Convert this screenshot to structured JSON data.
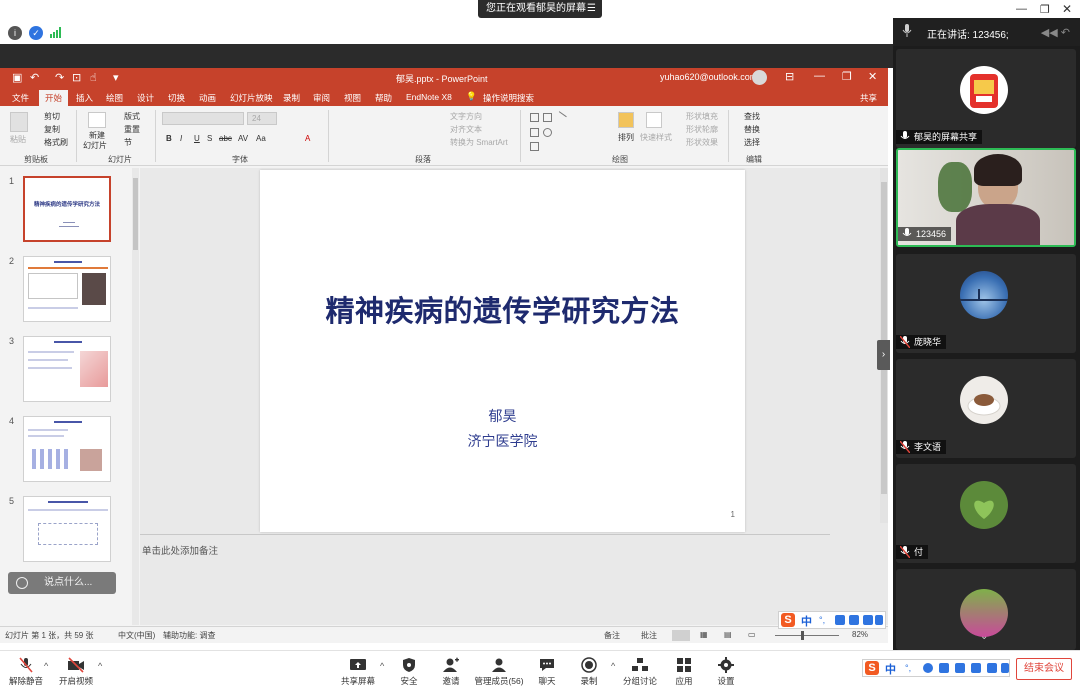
{
  "topbar": {
    "share_banner": "您正在观看郁昊的屏幕"
  },
  "ppt": {
    "doc_title": "郁昊.pptx - PowerPoint",
    "account": "yuhao620@outlook.com",
    "share_label": "共享",
    "tabs": [
      "文件",
      "开始",
      "插入",
      "绘图",
      "设计",
      "切换",
      "动画",
      "幻灯片放映",
      "录制",
      "审阅",
      "视图",
      "帮助",
      "EndNote X8",
      "操作说明搜索"
    ],
    "ribbon": {
      "clipboard": {
        "label": "剪贴板",
        "paste": "粘贴",
        "cut": "剪切",
        "copy": "复制",
        "format_painter": "格式刷"
      },
      "slides": {
        "label": "幻灯片",
        "new_slide": "新建",
        "new_slide2": "幻灯片",
        "layout": "版式",
        "reset": "重置",
        "section": "节"
      },
      "font": {
        "label": "字体",
        "size": "24",
        "bold": "B",
        "italic": "I",
        "underline": "U",
        "shadow": "S",
        "strike": "abc",
        "spacing": "AV",
        "case": "Aa",
        "color_a": "A"
      },
      "paragraph": {
        "label": "段落",
        "text_dir": "文字方向",
        "align_text": "对齐文本",
        "smartart": "转换为 SmartArt"
      },
      "drawing": {
        "label": "绘图",
        "arrange": "排列",
        "quick_styles": "快速样式",
        "fill": "形状填充",
        "outline": "形状轮廓",
        "effects": "形状效果"
      },
      "editing": {
        "label": "编辑",
        "find": "查找",
        "replace": "替换",
        "select": "选择"
      }
    },
    "thumbnails": [
      {
        "num": "1",
        "title": "精神疾病的遗传学研究方法"
      },
      {
        "num": "2",
        "title": ""
      },
      {
        "num": "3",
        "title": ""
      },
      {
        "num": "4",
        "title": ""
      },
      {
        "num": "5",
        "title": ""
      }
    ],
    "slide": {
      "title": "精神疾病的遗传学研究方法",
      "author": "郁昊",
      "institution": "济宁医学院",
      "page": "1"
    },
    "notes_placeholder": "单击此处添加备注",
    "status": {
      "slide_info": "幻灯片 第 1 张，共 59 张",
      "language": "中文(中国)",
      "accessibility": "辅助功能: 调查",
      "notes": "备注",
      "comments": "批注",
      "zoom": "82%"
    }
  },
  "chat_bubble": "说点什么...",
  "ime": {
    "zh": "中"
  },
  "panel": {
    "speaking_label": "正在讲话: 123456;",
    "participants": [
      {
        "name": "郁昊的屏幕共享",
        "type": "screen"
      },
      {
        "name": "123456",
        "type": "video"
      },
      {
        "name": "庞晓华",
        "type": "avatar"
      },
      {
        "name": "李文语",
        "type": "avatar"
      },
      {
        "name": "付",
        "type": "avatar"
      },
      {
        "name": "",
        "type": "avatar"
      }
    ]
  },
  "toolbar": {
    "unmute": "解除静音",
    "start_video": "开启视频",
    "share_screen": "共享屏幕",
    "security": "安全",
    "invite": "邀请",
    "manage_members": "管理成员(56)",
    "chat": "聊天",
    "record": "录制",
    "breakout": "分组讨论",
    "apps": "应用",
    "settings": "设置",
    "end_meeting": "结束会议"
  },
  "colors": {
    "ppt_accent": "#c6422b",
    "slide_title": "#1e2a6e",
    "active_speaker": "#2dbb55",
    "end_button": "#e0463c"
  }
}
